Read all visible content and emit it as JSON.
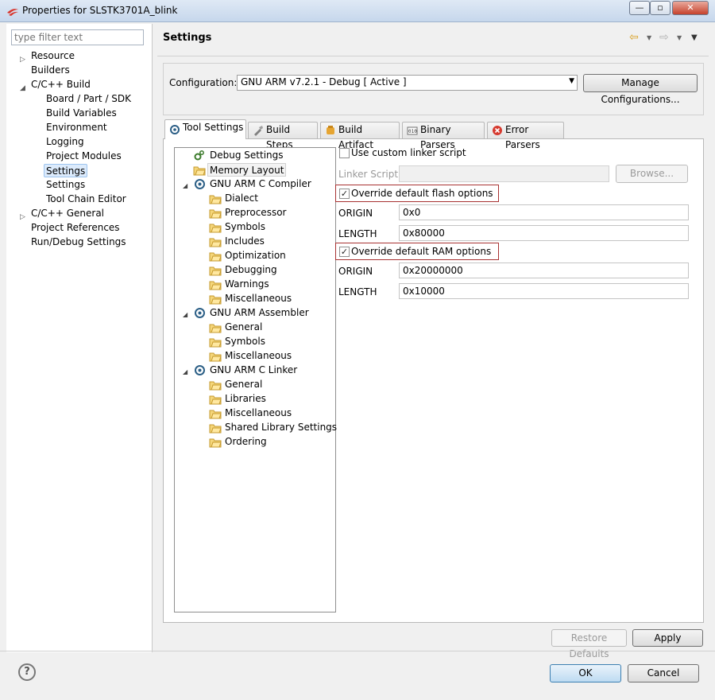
{
  "window": {
    "title": "Properties for SLSTK3701A_blink",
    "btn_min": "—",
    "btn_max": "▫",
    "btn_close": "✕"
  },
  "filter": {
    "placeholder": "type filter text"
  },
  "nav": {
    "items": [
      {
        "label": "Resource"
      },
      {
        "label": "Builders"
      },
      {
        "label": "C/C++ Build"
      },
      {
        "label": "Board / Part / SDK"
      },
      {
        "label": "Build Variables"
      },
      {
        "label": "Environment"
      },
      {
        "label": "Logging"
      },
      {
        "label": "Project Modules"
      },
      {
        "label": "Settings"
      },
      {
        "label": "Settings"
      },
      {
        "label": "Tool Chain Editor"
      },
      {
        "label": "C/C++ General"
      },
      {
        "label": "Project References"
      },
      {
        "label": "Run/Debug Settings"
      }
    ]
  },
  "main": {
    "title": "Settings"
  },
  "config": {
    "label": "Configuration:",
    "value": "GNU ARM v7.2.1 - Debug  [ Active ]",
    "manage_label": "Manage Configurations..."
  },
  "tabs": [
    {
      "label": "Tool Settings",
      "icon": "tool-settings-icon"
    },
    {
      "label": "Build Steps",
      "icon": "build-steps-icon"
    },
    {
      "label": "Build Artifact",
      "icon": "build-artifact-icon"
    },
    {
      "label": "Binary Parsers",
      "icon": "binary-parsers-icon"
    },
    {
      "label": "Error Parsers",
      "icon": "error-parsers-icon"
    }
  ],
  "tree": {
    "nodes": [
      {
        "label": "Debug Settings"
      },
      {
        "label": "Memory Layout"
      },
      {
        "label": "GNU ARM C Compiler"
      },
      {
        "label": "Dialect"
      },
      {
        "label": "Preprocessor"
      },
      {
        "label": "Symbols"
      },
      {
        "label": "Includes"
      },
      {
        "label": "Optimization"
      },
      {
        "label": "Debugging"
      },
      {
        "label": "Warnings"
      },
      {
        "label": "Miscellaneous"
      },
      {
        "label": "GNU ARM Assembler"
      },
      {
        "label": "General"
      },
      {
        "label": "Symbols"
      },
      {
        "label": "Miscellaneous"
      },
      {
        "label": "GNU ARM C Linker"
      },
      {
        "label": "General"
      },
      {
        "label": "Libraries"
      },
      {
        "label": "Miscellaneous"
      },
      {
        "label": "Shared Library Settings"
      },
      {
        "label": "Ordering"
      }
    ]
  },
  "linker": {
    "custom_label": "Use custom linker script",
    "custom_checked": false,
    "script_label": "Linker Script:",
    "script_value": "",
    "browse_label": "Browse..."
  },
  "flash": {
    "override_label": "Override default flash options",
    "override_checked": true,
    "origin_label": "ORIGIN",
    "origin_value": "0x0",
    "length_label": "LENGTH",
    "length_value": "0x80000"
  },
  "ram": {
    "override_label": "Override default RAM options",
    "override_checked": true,
    "origin_label": "ORIGIN",
    "origin_value": "0x20000000",
    "length_label": "LENGTH",
    "length_value": "0x10000"
  },
  "buttons": {
    "restore_defaults": "Restore Defaults",
    "apply": "Apply",
    "ok": "OK",
    "cancel": "Cancel",
    "help": "?"
  },
  "glyphs": {
    "check": "✓",
    "arrow_right": "▷",
    "arrow_down": "◢",
    "dropdown": "▼",
    "back": "⇦",
    "forward": "⇨"
  }
}
